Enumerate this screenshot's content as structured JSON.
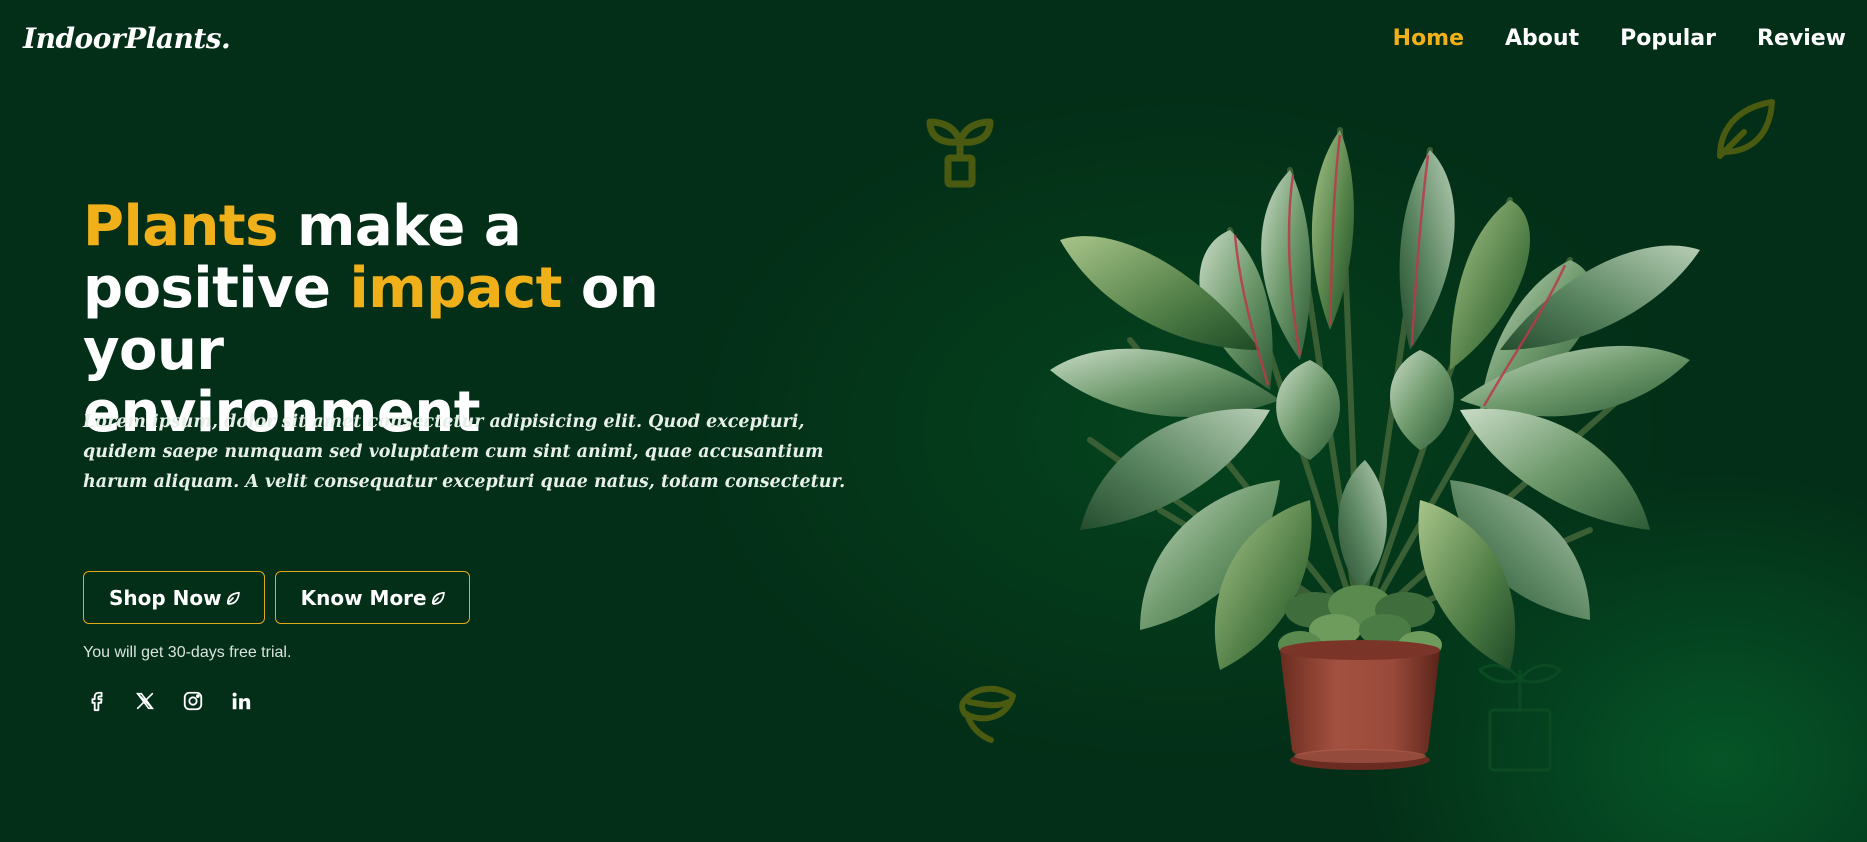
{
  "brand": {
    "logo": "IndoorPlants."
  },
  "nav": {
    "items": [
      {
        "label": "Home",
        "active": true
      },
      {
        "label": "About",
        "active": false
      },
      {
        "label": "Popular",
        "active": false
      },
      {
        "label": "Review",
        "active": false
      }
    ]
  },
  "hero": {
    "title_parts": [
      "Plants",
      " make a",
      "positive ",
      "impact",
      " on your",
      "environment"
    ],
    "description": "Lorem ipsum, dolor sit amet consectetur adipisicing elit. Quod excepturi, quidem saepe numquam sed voluptatem cum sint animi, quae accusantium harum aliquam. A velit consequatur excepturi quae natus, totam consectetur.",
    "buttons": {
      "shop": "Shop Now",
      "know": "Know More"
    },
    "trial_note": "You will get 30-days free trial."
  },
  "socials": [
    "facebook-icon",
    "x-icon",
    "instagram-icon",
    "linkedin-icon"
  ],
  "colors": {
    "background": "#032e17",
    "accent": "#f0b01a",
    "deco": "#4a5a10",
    "text": "#ffffff"
  }
}
